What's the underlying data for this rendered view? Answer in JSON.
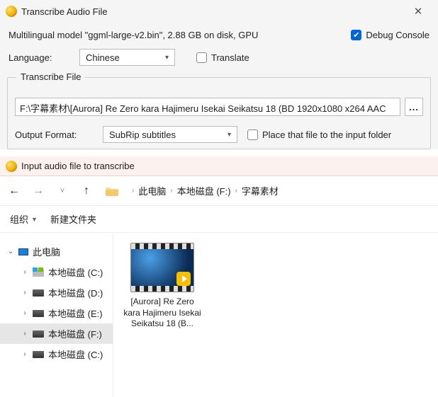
{
  "dialog": {
    "title": "Transcribe Audio File",
    "model_line": "Multilingual model \"ggml-large-v2.bin\", 2.88 GB on disk, GPU",
    "debug_label": "Debug Console",
    "language_label": "Language:",
    "language_value": "Chinese",
    "translate_label": "Translate",
    "group_legend": "Transcribe File",
    "path_value": "F:\\字幕素材\\[Aurora] Re Zero kara Hajimeru Isekai Seikatsu 18 (BD 1920x1080 x264 AAC",
    "browse_label": "...",
    "output_label": "Output Format:",
    "output_value": "SubRip subtitles",
    "place_label": "Place that file to the input folder"
  },
  "picker": {
    "title": "Input audio file to transcribe",
    "breadcrumb": [
      "此电脑",
      "本地磁盘 (F:)",
      "字幕素材"
    ],
    "toolbar_organize": "组织",
    "toolbar_newfolder": "新建文件夹",
    "tree_root": "此电脑",
    "drives": [
      {
        "label": "本地磁盘 (C:)",
        "selected": false,
        "icon": "win"
      },
      {
        "label": "本地磁盘 (D:)",
        "selected": false,
        "icon": "disk"
      },
      {
        "label": "本地磁盘 (E:)",
        "selected": false,
        "icon": "disk"
      },
      {
        "label": "本地磁盘 (F:)",
        "selected": true,
        "icon": "disk"
      },
      {
        "label": "本地磁盘 (C:)",
        "selected": false,
        "icon": "disk"
      }
    ],
    "file_name": "[Aurora] Re Zero kara Hajimeru Isekai Seikatsu 18 (B...",
    "file_badge": "Player"
  }
}
